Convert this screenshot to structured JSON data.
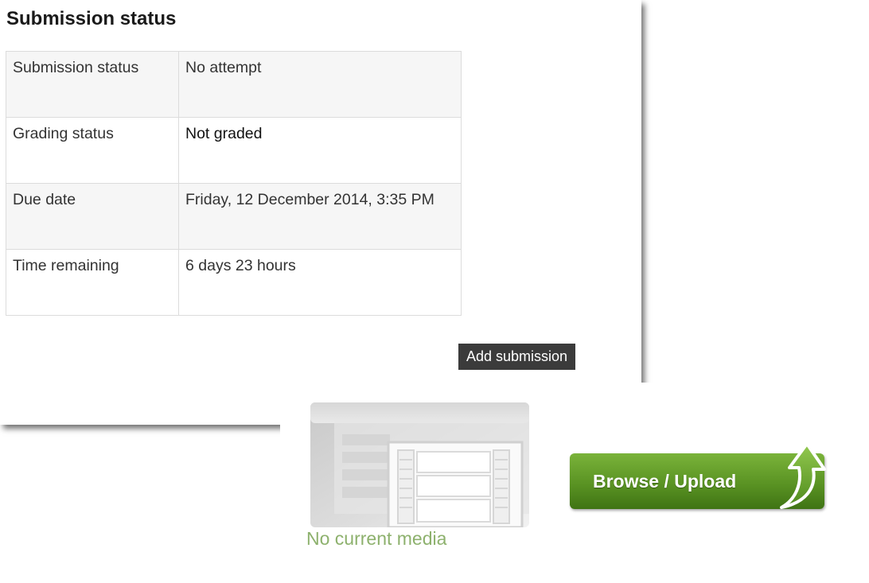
{
  "section": {
    "title": "Submission status"
  },
  "status_table": {
    "rows": [
      {
        "label": "Submission status",
        "value": "No attempt"
      },
      {
        "label": "Grading status",
        "value": "Not graded"
      },
      {
        "label": "Due date",
        "value": "Friday, 12 December 2014, 3:35 PM"
      },
      {
        "label": "Time remaining",
        "value": "6 days 23 hours"
      }
    ]
  },
  "actions": {
    "add_submission_label": "Add submission"
  },
  "media": {
    "caption": "No current media",
    "thumbnail_icon": "film-placeholder-icon",
    "browse_label": "Browse / Upload",
    "browse_icon": "up-arrow-icon"
  },
  "colors": {
    "add_button": "#3b3b3b",
    "browse_green": "#5a9323",
    "caption_green": "#8db16d"
  }
}
